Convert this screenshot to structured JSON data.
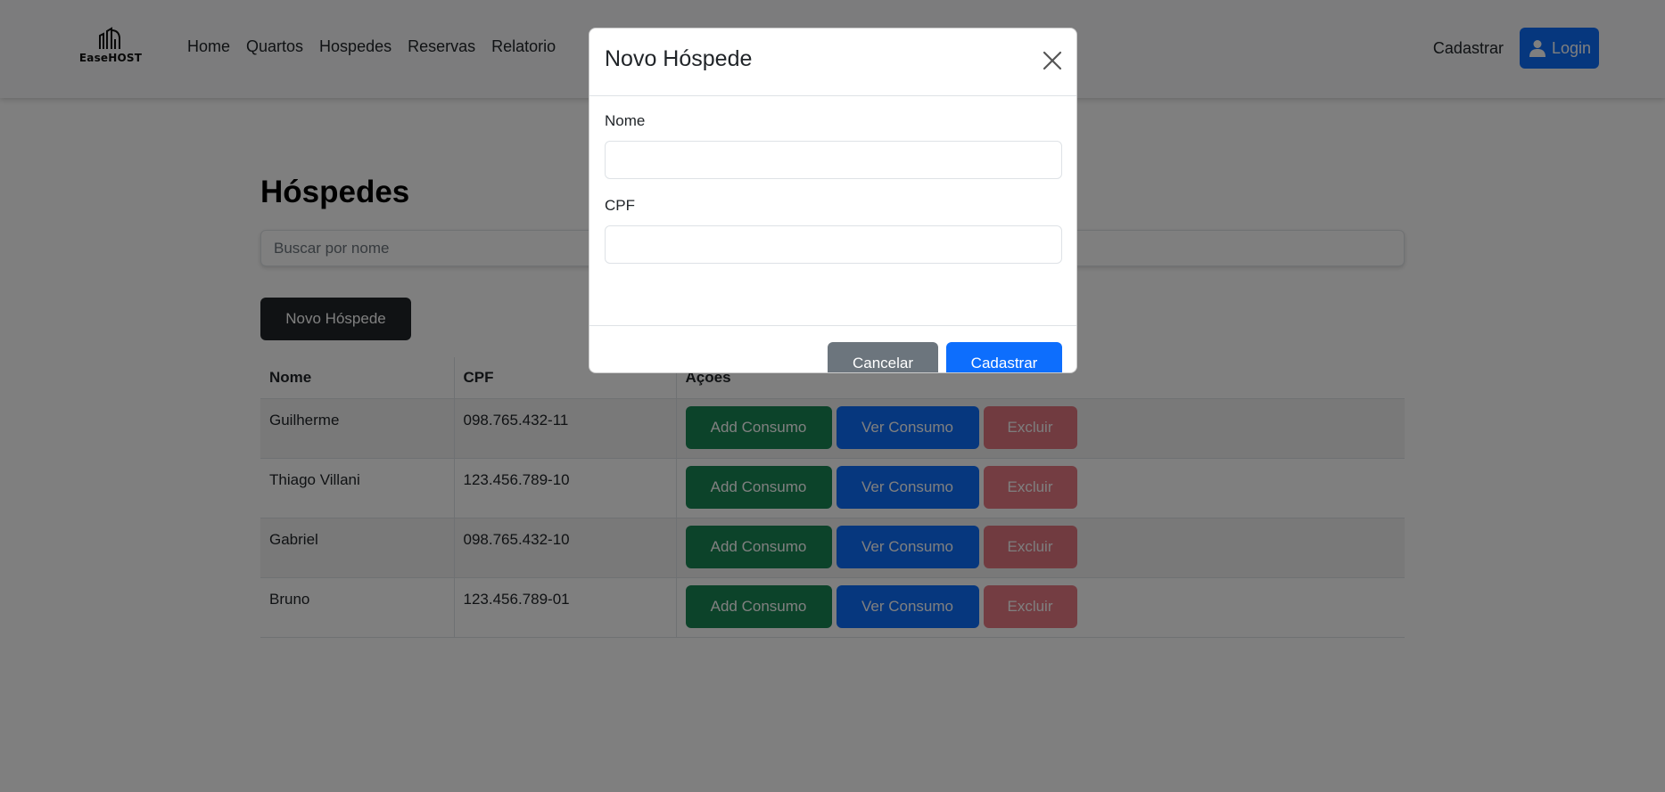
{
  "navbar": {
    "brand": "EaseHOST",
    "brand_icon": "building-icon",
    "links": [
      "Home",
      "Quartos",
      "Hospedes",
      "Reservas",
      "Relatorio"
    ],
    "register_label": "Cadastrar",
    "login_label": "Login",
    "login_icon": "user-icon"
  },
  "main": {
    "title": "Hóspedes",
    "search_placeholder": "Buscar por nome",
    "new_button_label": "Novo Hóspede",
    "table": {
      "columns": [
        "Nome",
        "CPF",
        "Ações"
      ],
      "rows": [
        {
          "nome": "Guilherme",
          "cpf": "098.765.432-11"
        },
        {
          "nome": "Thiago Villani",
          "cpf": "123.456.789-10"
        },
        {
          "nome": "Gabriel",
          "cpf": "098.765.432-10"
        },
        {
          "nome": "Bruno",
          "cpf": "123.456.789-01"
        }
      ],
      "actions": {
        "add": "Add Consumo",
        "see": "Ver Consumo",
        "delete": "Excluir"
      }
    }
  },
  "modal": {
    "title": "Novo Hóspede",
    "close_icon": "close-icon",
    "fields": {
      "name_label": "Nome",
      "name_value": "",
      "cpf_label": "CPF",
      "cpf_value": ""
    },
    "cancel_label": "Cancelar",
    "submit_label": "Cadastrar"
  },
  "colors": {
    "primary": "#0d6efd",
    "success": "#198754",
    "danger": "#dc3545",
    "secondary": "#6c757d",
    "dark": "#212529"
  }
}
